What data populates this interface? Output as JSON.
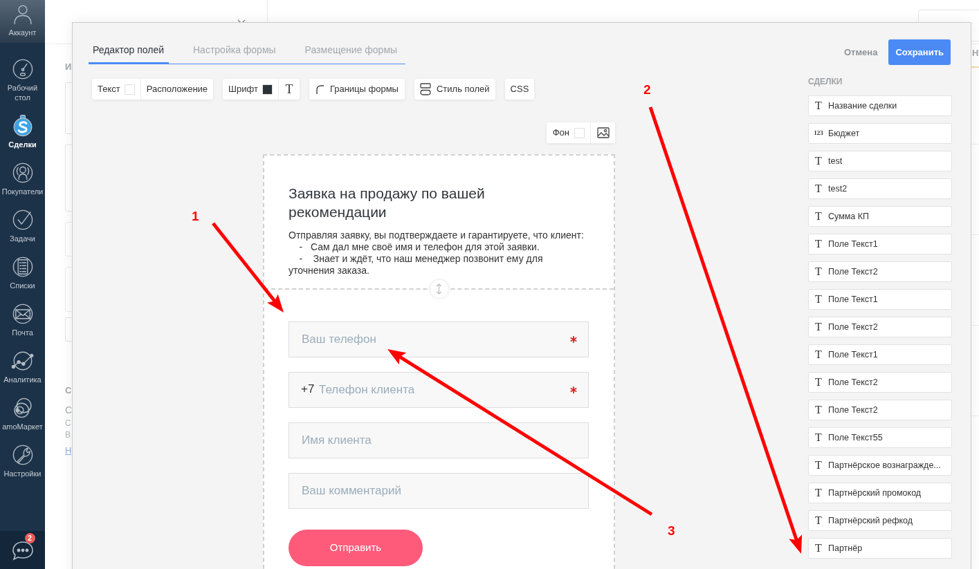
{
  "sidebar": {
    "items": [
      {
        "label": "Аккаунт",
        "kind": "account",
        "selected": false
      },
      {
        "label": "Рабочий стол",
        "kind": "dashboard",
        "selected": false
      },
      {
        "label": "Сделки",
        "kind": "deals",
        "selected": true
      },
      {
        "label": "Покупатели",
        "kind": "customers",
        "selected": false
      },
      {
        "label": "Задачи",
        "kind": "tasks",
        "selected": false
      },
      {
        "label": "Списки",
        "kind": "lists",
        "selected": false
      },
      {
        "label": "Почта",
        "kind": "mail",
        "selected": false
      },
      {
        "label": "Аналитика",
        "kind": "analytics",
        "selected": false
      },
      {
        "label": "amoМаркет",
        "kind": "market",
        "selected": false
      },
      {
        "label": "Настройки",
        "kind": "settings",
        "selected": false
      }
    ],
    "chat": {
      "badge": "2"
    }
  },
  "background_page": {
    "left_fragments": [
      {
        "text": "И",
        "kind": "heading"
      },
      {
        "text": "С",
        "kind": "heading"
      },
      {
        "text": "С",
        "kind": "large"
      },
      {
        "text": "С",
        "kind": "text"
      },
      {
        "text": "В",
        "kind": "text"
      },
      {
        "text": "Н",
        "kind": "link"
      }
    ],
    "right_fragment": "Н"
  },
  "modal": {
    "tabs": [
      {
        "label": "Редактор полей",
        "selected": true
      },
      {
        "label": "Настройка формы",
        "selected": false
      },
      {
        "label": "Размещение формы",
        "selected": false
      }
    ],
    "toolbar": [
      {
        "items": [
          {
            "kind": "color",
            "label": "Текст",
            "color": "#ffffff"
          },
          {
            "kind": "plain",
            "label": "Расположение"
          }
        ]
      },
      {
        "items": [
          {
            "kind": "color",
            "label": "Шрифт",
            "color": "#2b323a"
          },
          {
            "kind": "font",
            "label": "T"
          }
        ]
      },
      {
        "items": [
          {
            "kind": "borders",
            "label": "Границы формы"
          }
        ]
      },
      {
        "items": [
          {
            "kind": "fields",
            "label": "Стиль полей"
          }
        ]
      },
      {
        "items": [
          {
            "kind": "plain",
            "label": "CSS"
          }
        ]
      }
    ],
    "background_tool": {
      "label": "Фон",
      "color": "#ffffff"
    },
    "form": {
      "title": "Заявка на продажу по вашей рекомендации",
      "description": "Отправляя заявку, вы подтверждаете и гарантируете, что клиент:\n    -   Сам дал мне своё имя и телефон для этой заявки.\n    -    Знает и ждёт, что наш менеджер позвонит ему для уточнения заказа.",
      "fields": [
        {
          "placeholder": "Ваш телефон",
          "required": true
        },
        {
          "prefix": "+7",
          "placeholder": "Телефон клиента",
          "required": true
        },
        {
          "placeholder": "Имя клиента",
          "required": false
        },
        {
          "placeholder": "Ваш комментарий",
          "required": false
        }
      ],
      "submit": "Отправить"
    },
    "actions": {
      "cancel": "Отмена",
      "save": "Сохранить"
    },
    "field_library": {
      "heading": "СДЕЛКИ",
      "items": [
        {
          "kind": "text",
          "icon": "T",
          "label": "Название сделки"
        },
        {
          "kind": "number",
          "icon": "123",
          "label": "Бюджет"
        },
        {
          "kind": "text",
          "icon": "T",
          "label": "test"
        },
        {
          "kind": "text",
          "icon": "T",
          "label": "test2"
        },
        {
          "kind": "text",
          "icon": "T",
          "label": "Сумма КП"
        },
        {
          "kind": "text",
          "icon": "T",
          "label": "Поле Текст1"
        },
        {
          "kind": "text",
          "icon": "T",
          "label": "Поле Текст2"
        },
        {
          "kind": "text",
          "icon": "T",
          "label": "Поле Текст1"
        },
        {
          "kind": "text",
          "icon": "T",
          "label": "Поле Текст2"
        },
        {
          "kind": "text",
          "icon": "T",
          "label": "Поле Текст1"
        },
        {
          "kind": "text",
          "icon": "T",
          "label": "Поле Текст2"
        },
        {
          "kind": "text",
          "icon": "T",
          "label": "Поле Текст2"
        },
        {
          "kind": "text",
          "icon": "T",
          "label": "Поле Текст55"
        },
        {
          "kind": "text",
          "icon": "T",
          "label": "Партнёрское вознагражде..."
        },
        {
          "kind": "text",
          "icon": "T",
          "label": "Партнёрский промокод"
        },
        {
          "kind": "text",
          "icon": "T",
          "label": "Партнёрский рефкод"
        },
        {
          "kind": "text",
          "icon": "T",
          "label": "Партнёр"
        }
      ]
    }
  },
  "annotations": [
    {
      "label": "1"
    },
    {
      "label": "2"
    },
    {
      "label": "3"
    }
  ]
}
